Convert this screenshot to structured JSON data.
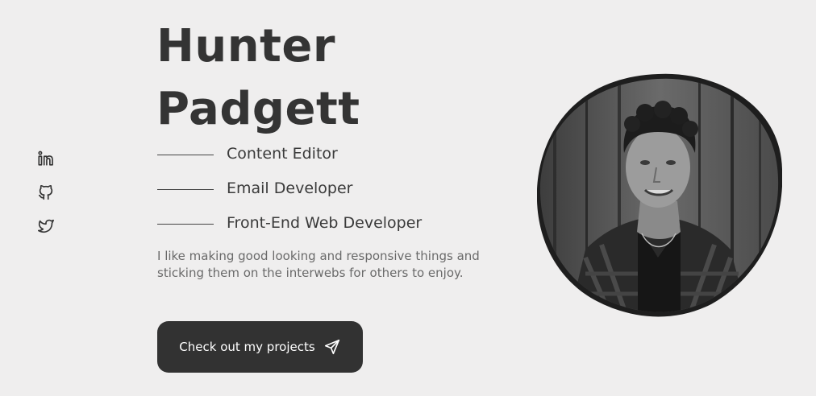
{
  "hero": {
    "first_name": "Hunter",
    "last_name": "Padgett",
    "roles": [
      "Content Editor",
      "Email Developer",
      "Front-End Web Developer"
    ],
    "bio": "I like making good looking and responsive things and sticking them on the interwebs for others to enjoy.",
    "cta_label": "Check out my projects",
    "cta_icon": "paper-plane-icon"
  },
  "socials": [
    {
      "icon": "linkedin-icon"
    },
    {
      "icon": "github-icon"
    },
    {
      "icon": "twitter-icon"
    }
  ],
  "portrait": {
    "subject": "grayscale-profile-photo"
  },
  "colors": {
    "background": "#efeeee",
    "text_dark": "#343434",
    "text_muted": "#6a6a6a",
    "button_bg": "#323232",
    "button_text": "#ffffff"
  }
}
